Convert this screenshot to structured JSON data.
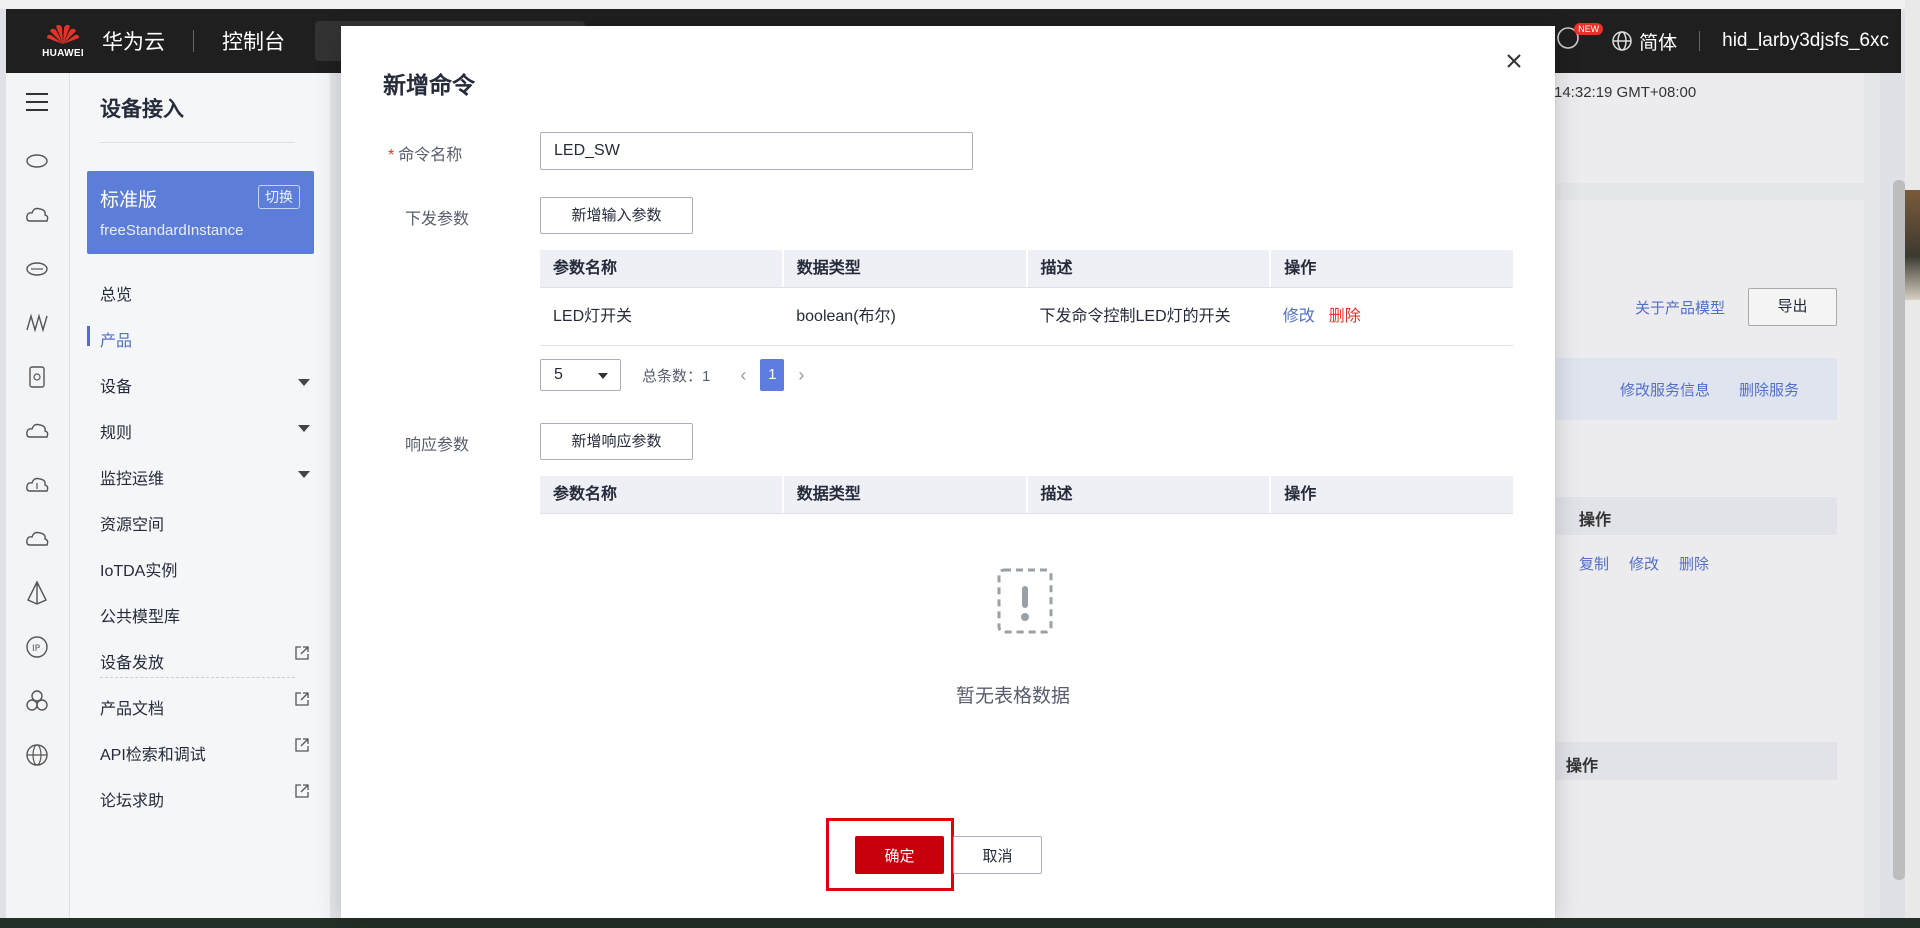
{
  "topbar": {
    "brand_text": "HUAWEI",
    "cloud_name": "华为云",
    "console": "控制台",
    "new_badge": "NEW",
    "language": "简体",
    "username": "hid_larby3djsfs_6xc"
  },
  "sidemenu": {
    "title": "设备接入",
    "edition": {
      "name": "标准版",
      "switch_label": "切换",
      "instance": "freeStandardInstance"
    },
    "items": [
      {
        "label": "总览"
      },
      {
        "label": "产品"
      },
      {
        "label": "设备"
      },
      {
        "label": "规则"
      },
      {
        "label": "监控运维"
      },
      {
        "label": "资源空间"
      },
      {
        "label": "IoTDA实例"
      },
      {
        "label": "公共模型库"
      },
      {
        "label": "设备发放"
      },
      {
        "label": "产品文档"
      },
      {
        "label": "API检索和调试"
      },
      {
        "label": "论坛求助"
      }
    ]
  },
  "background": {
    "timestamp": "14:32:19 GMT+08:00",
    "about_model_link": "关于产品模型",
    "export_button": "导出",
    "modify_service": "修改服务信息",
    "delete_service": "删除服务",
    "ops_header": "操作",
    "copy": "复制",
    "modify": "修改",
    "delete": "删除",
    "ops_header_2": "操作"
  },
  "modal": {
    "title": "新增命令",
    "command_name_label": "命令名称",
    "command_name_value": "LED_SW",
    "send_params_label": "下发参数",
    "add_input_param_button": "新增输入参数",
    "table_headers": [
      "参数名称",
      "数据类型",
      "描述",
      "操作"
    ],
    "send_params_rows": [
      {
        "name": "LED灯开关",
        "type": "boolean(布尔)",
        "desc": "下发命令控制LED灯的开关",
        "edit": "修改",
        "delete": "删除"
      }
    ],
    "pager": {
      "page_size": "5",
      "total_label": "总条数：1",
      "current_page": "1"
    },
    "response_params_label": "响应参数",
    "add_response_param_button": "新增响应参数",
    "empty_text": "暂无表格数据",
    "confirm_button": "确定",
    "cancel_button": "取消"
  },
  "colors": {
    "accent": "#526ecc",
    "confirm": "#c7000b",
    "highlight": "#e3000f",
    "edition_bg": "#5d7ed8"
  }
}
